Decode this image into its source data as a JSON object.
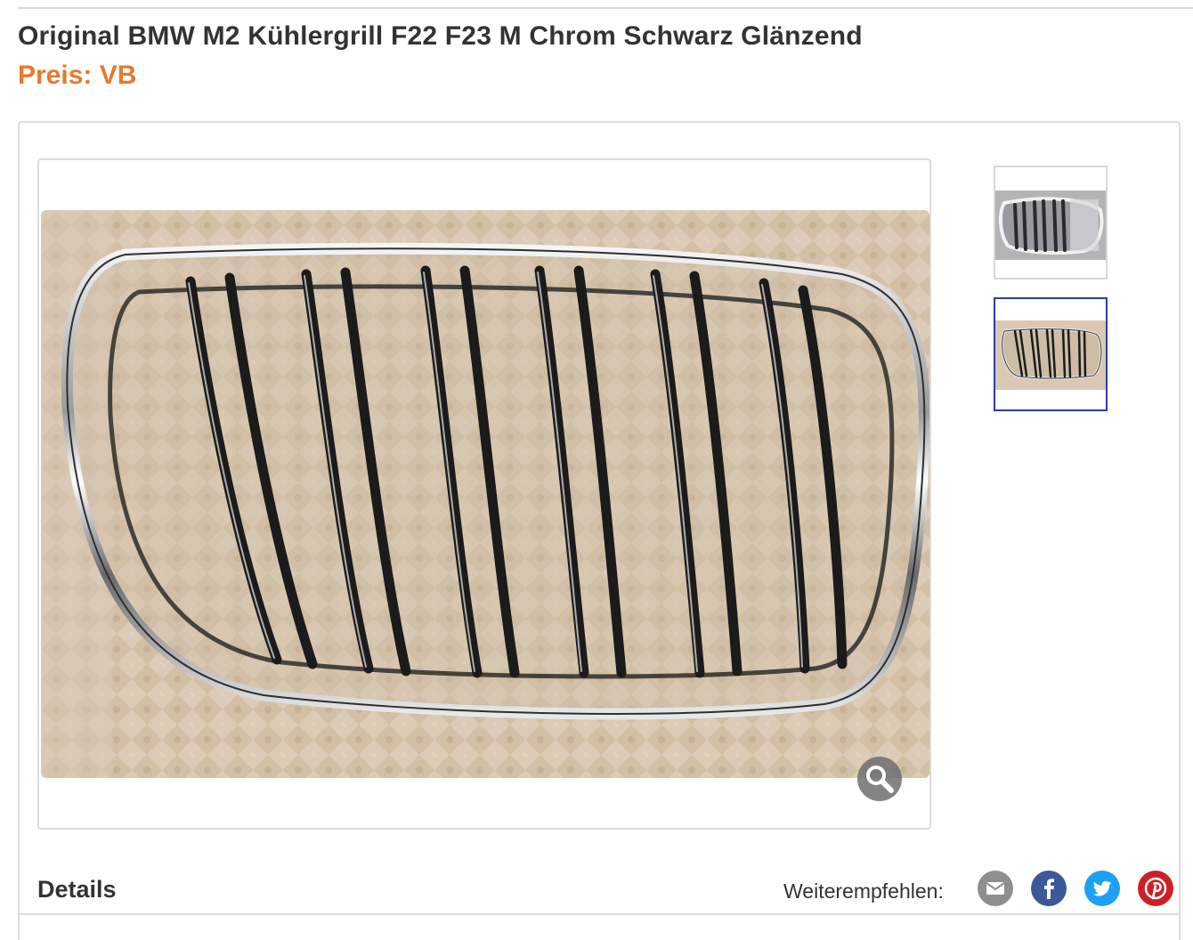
{
  "listing": {
    "title": "Original BMW M2 Kühlergrill F22 F23 M Chrom Schwarz Glänzend",
    "price": "Preis: VB"
  },
  "gallery": {
    "main_image": "kuehlergrill-photo",
    "selected_thumbnail": 2,
    "thumbnails": [
      "thumbnail-grill-front",
      "thumbnail-grill-side"
    ],
    "zoom_icon": "magnifier-icon"
  },
  "details": {
    "heading": "Details",
    "share_label": "Weiterempfehlen:",
    "share_buttons": [
      "email-icon",
      "facebook-icon",
      "twitter-icon",
      "pinterest-icon"
    ]
  },
  "colors": {
    "price": "#e57a2e",
    "selected_border": "#2d3bb0",
    "email": "#8f8f8f",
    "facebook": "#3b5998",
    "twitter": "#1da1f2",
    "pinterest": "#cb2027"
  }
}
